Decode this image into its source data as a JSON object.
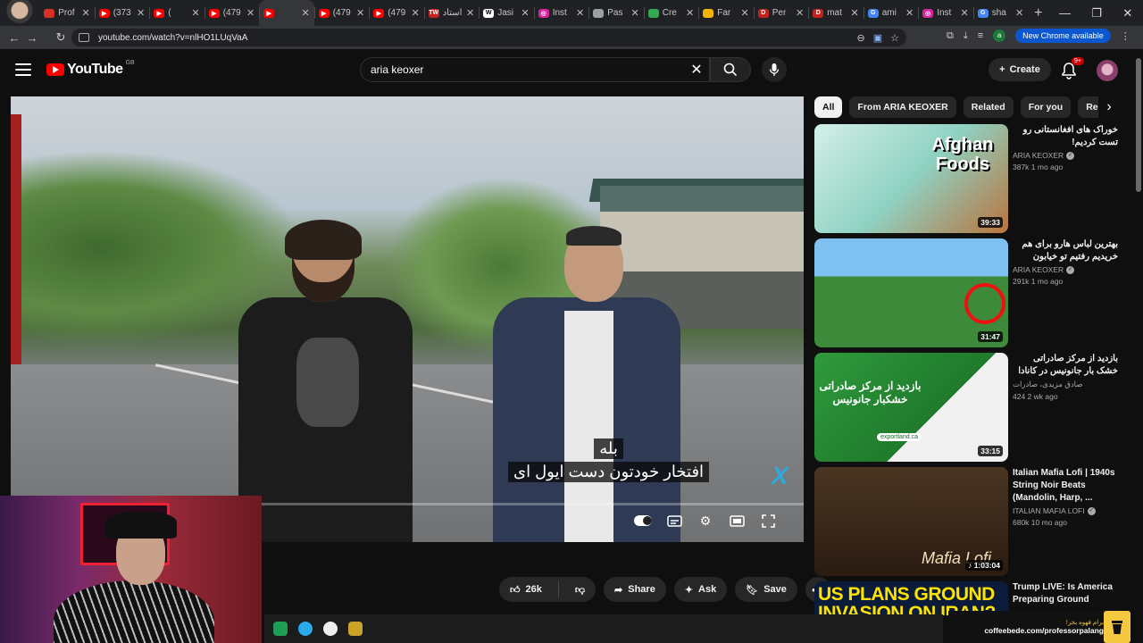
{
  "browser": {
    "tabs": [
      {
        "label": "Prof",
        "fav_color": "#d93025",
        "fav_text": ""
      },
      {
        "label": "(373",
        "fav_color": "#ff0000",
        "fav_text": "▶"
      },
      {
        "label": "(",
        "fav_color": "#ff0000",
        "fav_text": "▶"
      },
      {
        "label": "(479",
        "fav_color": "#ff0000",
        "fav_text": "▶"
      },
      {
        "label": "",
        "fav_color": "#ff0000",
        "fav_text": "▶"
      },
      {
        "label": "(479",
        "fav_color": "#ff0000",
        "fav_text": "▶"
      },
      {
        "label": "(479",
        "fav_color": "#ff0000",
        "fav_text": "▶"
      },
      {
        "label": "استاد",
        "fav_color": "#c5221f",
        "fav_text": "TW"
      },
      {
        "label": "Jasi",
        "fav_color": "#ffffff",
        "fav_text": "W"
      },
      {
        "label": "Inst",
        "fav_color": "#d6249f",
        "fav_text": "◎"
      },
      {
        "label": "Pas",
        "fav_color": "#9aa0a6",
        "fav_text": ""
      },
      {
        "label": "Cre",
        "fav_color": "#34a853",
        "fav_text": ""
      },
      {
        "label": "Far",
        "fav_color": "#f4b400",
        "fav_text": ""
      },
      {
        "label": "Per",
        "fav_color": "#c5221f",
        "fav_text": "D"
      },
      {
        "label": "mat",
        "fav_color": "#c5221f",
        "fav_text": "D"
      },
      {
        "label": "ami",
        "fav_color": "#4285f4",
        "fav_text": "G"
      },
      {
        "label": "Inst",
        "fav_color": "#d6249f",
        "fav_text": "◎"
      },
      {
        "label": "sha",
        "fav_color": "#4285f4",
        "fav_text": "G"
      }
    ],
    "active_tab_index": 4,
    "url": "youtube.com/watch?v=nlHO1LUqVaA",
    "profile_initial": "a",
    "new_chrome_label": "New Chrome available"
  },
  "youtube": {
    "logo_text": "YouTube",
    "region": "GB",
    "search_query": "aria keoxer",
    "create_label": "Create",
    "notification_count": "9+",
    "subtitles": [
      "بله",
      "افتخار خودتون دست ایول ای"
    ],
    "actions": {
      "likes": "26k",
      "share": "Share",
      "ask": "Ask",
      "save": "Save"
    },
    "chips": [
      "All",
      "From ARIA KEOXER",
      "Related",
      "For you",
      "Recent"
    ],
    "related": [
      {
        "title": "خوراک های افغانستانی رو تست کردیم!",
        "rtl": true,
        "channel": "ARIA KEOXER",
        "verified": true,
        "stats": "387k  1 mo ago",
        "duration": "39:33",
        "thumb_text": "Afghan Foods"
      },
      {
        "title": "بهترین لباس هارو برای هم خریدیم رفتیم تو خیابون (واکنش مردم) 🤩",
        "rtl": true,
        "channel": "ARIA KEOXER",
        "verified": true,
        "stats": "291k  1 mo ago",
        "duration": "31:47",
        "thumb_text": ""
      },
      {
        "title": "بازدید از مرکز صادراتی خشک بار جانونیس در کانادا #صادرات",
        "rtl": true,
        "channel": "صادق مزیدی، صادرات",
        "verified": false,
        "stats": "424  2 wk ago",
        "duration": "33:15",
        "thumb_text": "بازدید از مرکز صادراتی خشکبار جانونیس",
        "thumb_sub": "exportland.ca"
      },
      {
        "title": "Italian Mafia Lofi | 1940s String Noir Beats (Mandolin, Harp, ...",
        "rtl": false,
        "channel": "ITALIAN MAFIA LOFI",
        "verified": true,
        "stats": "680k  10 mo ago",
        "duration": "1:03:04",
        "thumb_text": "Mafia Lofi"
      },
      {
        "title": "Trump LIVE: Is America Preparing Ground Troops",
        "rtl": false,
        "thumb_text": "US PLANS GROUND INVASION ON IRAN?"
      }
    ]
  },
  "overlay": {
    "coffee_fa": "برام قهوه بخر!",
    "coffee_url": "coffeebede.com/professorpalang"
  }
}
